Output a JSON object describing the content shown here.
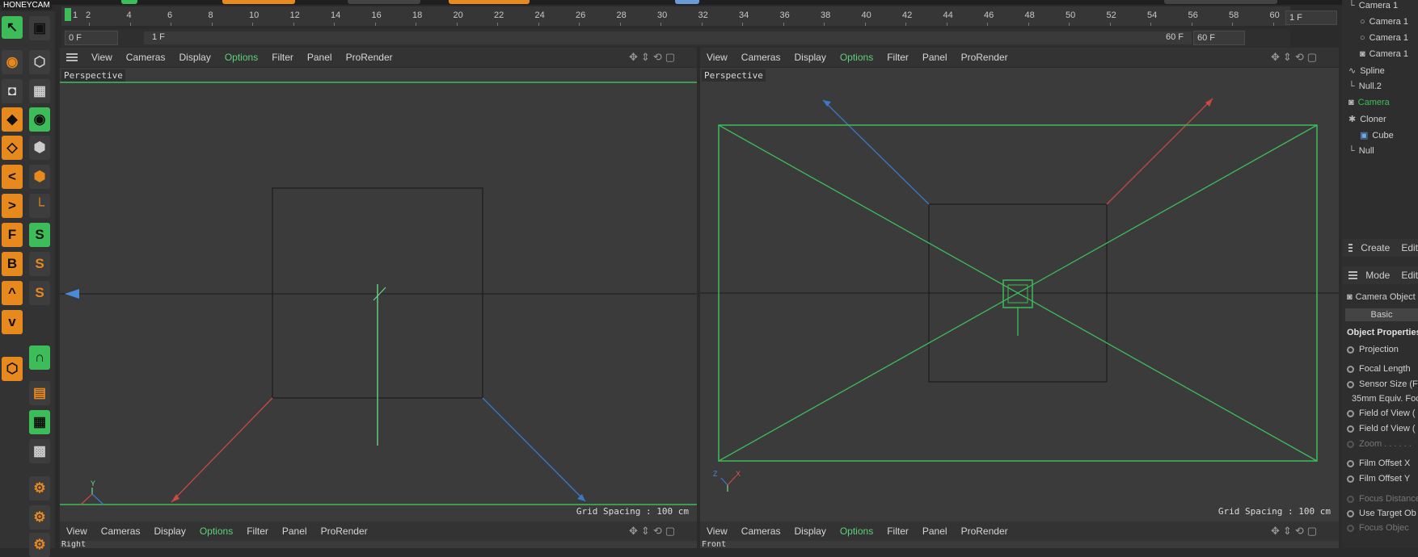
{
  "watermark": "HONEYCAM",
  "timeline": {
    "ticks": [
      "2",
      "4",
      "6",
      "8",
      "10",
      "12",
      "14",
      "16",
      "18",
      "20",
      "22",
      "24",
      "26",
      "28",
      "30",
      "32",
      "34",
      "36",
      "38",
      "40",
      "42",
      "44",
      "46",
      "48",
      "50",
      "52",
      "54",
      "56",
      "58",
      "60"
    ],
    "first_tick": "1",
    "end_field": "1 F",
    "current_frame": "0 F",
    "range_start": "1 F",
    "range_end": "60 F",
    "max_frame": "60 F"
  },
  "viewport_menu": [
    "View",
    "Cameras",
    "Display",
    "Options",
    "Filter",
    "Panel",
    "ProRender"
  ],
  "viewports": {
    "top_left": {
      "label": "Perspective",
      "grid": "Grid Spacing : 100 cm"
    },
    "top_right": {
      "label": "Perspective",
      "grid": "Grid Spacing : 100 cm"
    },
    "bottom_left": {
      "label": "Right"
    },
    "bottom_right": {
      "label": "Front"
    }
  },
  "axis_labels": {
    "y": "Y",
    "x": "X",
    "z": "Z"
  },
  "objects": [
    {
      "name": "Camera 1",
      "icon": "null-icon",
      "active": false
    },
    {
      "name": "Camera 1",
      "icon": "circle-icon",
      "active": false
    },
    {
      "name": "Camera 1",
      "icon": "circle-icon",
      "active": false
    },
    {
      "name": "Camera 1",
      "icon": "camera-icon",
      "active": false
    },
    {
      "name": "Spline",
      "icon": "spline-icon",
      "active": false
    },
    {
      "name": "Null.2",
      "icon": "null-icon",
      "active": false
    },
    {
      "name": "Camera",
      "icon": "camera-icon",
      "active": true
    },
    {
      "name": "Cloner",
      "icon": "cloner-icon",
      "active": false
    },
    {
      "name": "Cube",
      "icon": "cube-icon",
      "active": false
    },
    {
      "name": "Null",
      "icon": "null-icon",
      "active": false
    }
  ],
  "panel_tabs": {
    "create": "Create",
    "edit": "Edit",
    "mode": "Mode",
    "edit2": "Edit"
  },
  "attributes": {
    "object_title": "Camera Object",
    "basic_tab": "Basic",
    "section": "Object Properties",
    "rows": [
      "Projection",
      "Focal Length",
      "Sensor Size (F",
      "35mm Equiv. Foc",
      "Field of View (",
      "Field of View (",
      "Zoom . . . . . .",
      "Film Offset X",
      "Film Offset Y",
      "Focus Distance",
      "Use Target Ob",
      "Focus Objec"
    ]
  },
  "colors": {
    "accent_green": "#3dbd5a",
    "tool_orange": "#e8891e",
    "x_axis": "#c84a42",
    "z_axis": "#3a78c8"
  }
}
